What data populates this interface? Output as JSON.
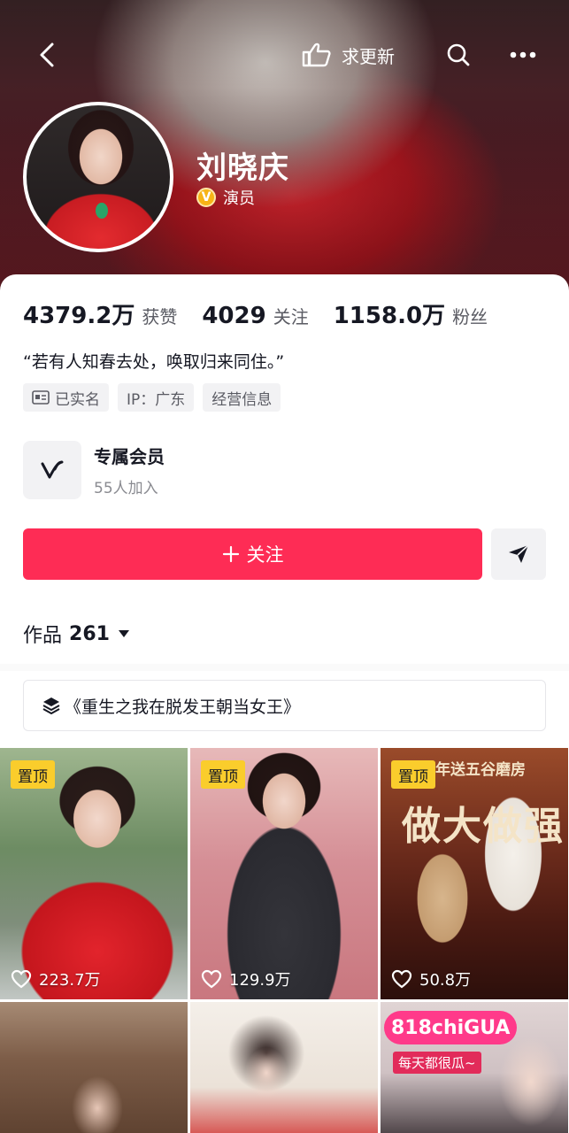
{
  "header": {
    "nudge_label": "求更新",
    "name": "刘晓庆",
    "verified_label": "演员"
  },
  "stats": [
    {
      "num": "4379.2万",
      "label": "获赞"
    },
    {
      "num": "4029",
      "label": "关注"
    },
    {
      "num": "1158.0万",
      "label": "粉丝"
    }
  ],
  "bio": "“若有人知春去处，唤取归来同住。”",
  "tags": {
    "real_name": "已实名",
    "ip": "IP：广东",
    "business": "经营信息"
  },
  "member": {
    "title": "专属会员",
    "subtitle": "55人加入"
  },
  "actions": {
    "follow_label": "关注"
  },
  "works": {
    "label": "作品",
    "count": "261"
  },
  "collection": {
    "title": "《重生之我在脱发王朝当女王》"
  },
  "videos": [
    {
      "pinned": "置顶",
      "likes": "223.7万"
    },
    {
      "pinned": "置顶",
      "likes": "129.9万"
    },
    {
      "pinned": "置顶",
      "likes": "50.8万",
      "poster_top": "年送五谷磨房",
      "poster_title": "做大做强"
    },
    {},
    {},
    {
      "brand": "818chiGUA",
      "slogan": "每天都很瓜~"
    }
  ],
  "colors": {
    "accent": "#fe2c55",
    "pin_badge": "#facd2c",
    "verified_badge": "#f7b416"
  }
}
